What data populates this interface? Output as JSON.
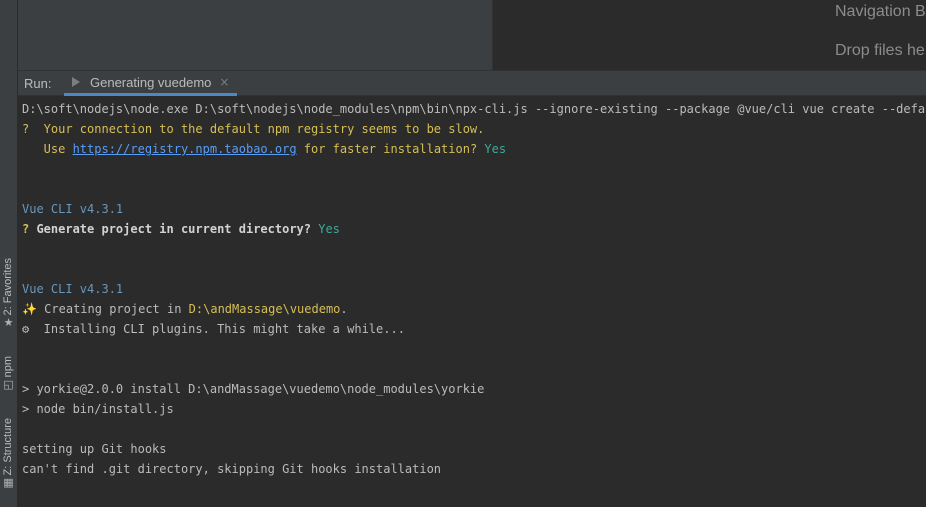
{
  "editor": {
    "hint_navigation": "Navigation Bar is Alt+Home",
    "hint_drop": "Drop files here to open"
  },
  "tool_stripe": {
    "favorites": "2: Favorites",
    "npm": "npm",
    "structure": "Z: Structure"
  },
  "run": {
    "label": "Run:",
    "tab_label": "Generating vuedemo",
    "close_glyph": "×"
  },
  "console": {
    "cmd": "D:\\soft\\nodejs\\node.exe D:\\soft\\nodejs\\node_modules\\npm\\bin\\npx-cli.js --ignore-existing --package @vue/cli vue create --default",
    "slow_prefix": "?  Your connection to the default npm registry seems to be slow.",
    "use_prefix": "   Use ",
    "registry_link": "https://registry.npm.taobao.org",
    "use_suffix": " for faster installation? ",
    "yes1": "Yes",
    "vue_cli_1": "Vue CLI v4.3.1",
    "generate_q": "? ",
    "generate_text": "Generate project in current directory?",
    "yes2": " Yes",
    "vue_cli_2": "Vue CLI v4.3.1",
    "creating_icon": "✨",
    "creating_prefix": " Creating project in ",
    "creating_path": "D:\\andMassage\\vuedemo",
    "creating_suffix": ".",
    "installing_icon": "⚙",
    "installing_text": "  Installing CLI plugins. This might take a while...",
    "yorkie": "> yorkie@2.0.0 install D:\\andMassage\\vuedemo\\node_modules\\yorkie",
    "node_install": "> node bin/install.js",
    "git_hooks": "setting up Git hooks",
    "cant_find": "can't find .git directory, skipping Git hooks installation"
  }
}
